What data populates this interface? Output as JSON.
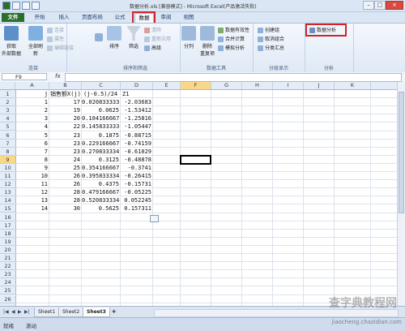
{
  "window": {
    "title": "数据分析.xls [兼容模式] - Microsoft Excel(产品激活失败)"
  },
  "tabs": [
    "文件",
    "开始",
    "插入",
    "页面布局",
    "公式",
    "数据",
    "审阅",
    "视图"
  ],
  "ribbon": {
    "connections": {
      "get_external": "获取\n外部数据",
      "refresh_all": "全部刷新",
      "connections": "连接",
      "properties": "属性",
      "edit_links": "编辑链接",
      "label": "连接"
    },
    "sort_filter": {
      "sort": "排序",
      "filter": "筛选",
      "clear": "清除",
      "reapply": "重新应用",
      "advanced": "高级",
      "label": "排序和筛选"
    },
    "data_tools": {
      "text_to_columns": "分列",
      "remove_duplicates": "删除\n重复项",
      "validation": "数据有效性",
      "consolidate": "合并计算",
      "what_if": "模拟分析",
      "label": "数据工具"
    },
    "outline": {
      "group": "创建组",
      "ungroup": "取消组合",
      "subtotal": "分类汇总",
      "label": "分级显示"
    },
    "analysis": {
      "data_analysis": "数据分析",
      "label": "分析"
    }
  },
  "formula_bar": {
    "name_box": "F9",
    "fx": "fx",
    "formula": ""
  },
  "columns": [
    "A",
    "B",
    "C",
    "D",
    "E",
    "F",
    "G",
    "H",
    "I",
    "J",
    "K"
  ],
  "rows": [
    "1",
    "2",
    "3",
    "4",
    "5",
    "6",
    "7",
    "8",
    "9",
    "10",
    "11",
    "12",
    "13",
    "14",
    "15",
    "16",
    "17",
    "18",
    "19",
    "20",
    "21",
    "22",
    "23",
    "24",
    "25",
    "26"
  ],
  "selected_cell": "F9",
  "table": {
    "headers": [
      "j",
      "销售额X(j)",
      "(j-0.5)/24",
      "Z1"
    ],
    "data": [
      [
        "1",
        "17",
        "0.020833333",
        "-2.03683"
      ],
      [
        "2",
        "19",
        "0.0625",
        "-1.53412"
      ],
      [
        "3",
        "20",
        "0.104166667",
        "-1.25816"
      ],
      [
        "4",
        "22",
        "0.145833333",
        "-1.05447"
      ],
      [
        "5",
        "23",
        "0.1875",
        "-0.88715"
      ],
      [
        "6",
        "23",
        "0.229166667",
        "-0.74159"
      ],
      [
        "7",
        "23",
        "0.270833334",
        "-0.61029"
      ],
      [
        "8",
        "24",
        "0.3125",
        "-0.48878"
      ],
      [
        "9",
        "25",
        "0.354166667",
        "-0.3741"
      ],
      [
        "10",
        "26",
        "0.395833334",
        "-0.26415"
      ],
      [
        "11",
        "26",
        "0.4375",
        "-0.15731"
      ],
      [
        "12",
        "28",
        "0.479166667",
        "-0.05225"
      ],
      [
        "13",
        "28",
        "0.520833334",
        "0.052245"
      ],
      [
        "14",
        "30",
        "0.5625",
        "0.157311"
      ]
    ]
  },
  "sheets": [
    "Sheet1",
    "Sheet2",
    "Sheet3"
  ],
  "active_sheet": "Sheet3",
  "status": {
    "ready": "就绪",
    "scroll": "滚动"
  },
  "watermark": {
    "main": "查字典教程网",
    "url": "jiaocheng.chazidian.com"
  },
  "colors": {
    "highlight": "#d0242b",
    "file_tab": "#2a6f2a",
    "selected_header": "#f8d888"
  }
}
